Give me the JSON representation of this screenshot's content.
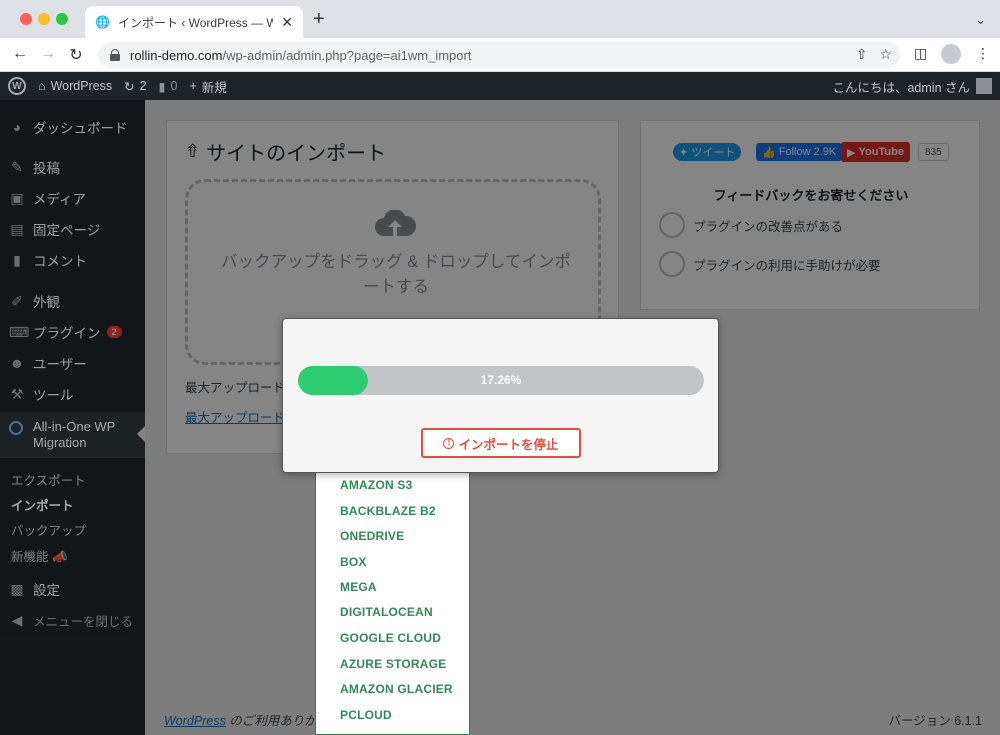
{
  "browser": {
    "tab_title": "インポート ‹ WordPress — WordPress",
    "url_host": "rollin-demo.com",
    "url_path": "/wp-admin/admin.php?page=ai1wm_import"
  },
  "adminbar": {
    "site_name": "WordPress",
    "updates_count": "2",
    "comments_count": "0",
    "new_label": "新規",
    "greeting": "こんにちは、admin さん"
  },
  "sidebar": {
    "items": [
      {
        "label": "ダッシュボード",
        "icon": "dashboard-icon"
      },
      {
        "label": "投稿",
        "icon": "pin-icon"
      },
      {
        "label": "メディア",
        "icon": "media-icon"
      },
      {
        "label": "固定ページ",
        "icon": "page-icon"
      },
      {
        "label": "コメント",
        "icon": "comment-icon"
      },
      {
        "label": "外観",
        "icon": "brush-icon"
      },
      {
        "label": "プラグイン",
        "icon": "plugin-icon",
        "badge": "2"
      },
      {
        "label": "ユーザー",
        "icon": "user-icon"
      },
      {
        "label": "ツール",
        "icon": "wrench-icon"
      }
    ],
    "active_label": "All-in-One WP Migration",
    "sub_items": [
      "エクスポート",
      "インポート",
      "バックアップ",
      "新機能"
    ],
    "settings_label": "設定",
    "collapse_label": "メニューを閉じる"
  },
  "import_box": {
    "title": "サイトのインポート",
    "dropzone_text": "バックアップをドラッグ & ドロップしてインポートする",
    "max_upload_label": "最大アップロード",
    "max_upload_link": "最大アップロード"
  },
  "dropdown": {
    "items": [
      "AMAZON S3",
      "BACKBLAZE B2",
      "ONEDRIVE",
      "BOX",
      "MEGA",
      "DIGITALOCEAN",
      "GOOGLE CLOUD",
      "AZURE STORAGE",
      "AMAZON GLACIER",
      "PCLOUD"
    ]
  },
  "social": {
    "tweet": "ツイート",
    "follow": "Follow 2.9K",
    "youtube": "YouTube",
    "youtube_count": "835"
  },
  "feedback": {
    "title": "フィードバックをお寄せください",
    "options": [
      "プラグインの改善点がある",
      "プラグインの利用に手助けが必要"
    ]
  },
  "footer": {
    "link": "WordPress",
    "text": " のご利用ありがと",
    "version": "バージョン 6.1.1"
  },
  "modal": {
    "progress_percent": 17.26,
    "progress_label": "17.26%",
    "stop_button": "インポートを停止"
  },
  "colors": {
    "progress_fill": "#2ecc71",
    "stop_red": "#e74c3c",
    "wp_dark": "#1d2327",
    "link_blue": "#2271b1"
  }
}
